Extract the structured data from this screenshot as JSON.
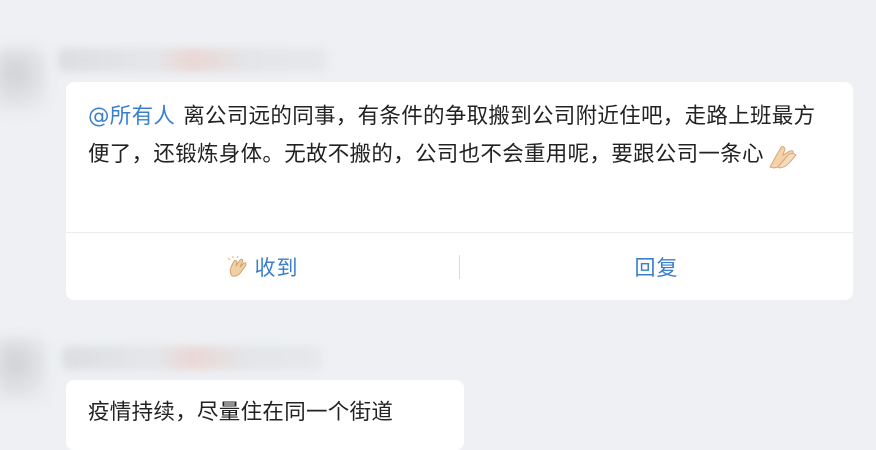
{
  "messages": [
    {
      "mention": "@所有人",
      "text": "离公司远的同事，有条件的争取搬到公司附近住吧，走路上班最方便了，还锻炼身体。无故不搬的，公司也不会重用呢，要跟公司一条心",
      "emoji": "pray-icon",
      "actions": {
        "received_label": "收到",
        "received_icon": "clap-hands-icon",
        "reply_label": "回复"
      }
    },
    {
      "text": "疫情持续，尽量住在同一个街道"
    }
  ],
  "colors": {
    "accent": "#3a7fce",
    "background": "#eef0f3",
    "card": "#ffffff",
    "text": "#222222"
  }
}
